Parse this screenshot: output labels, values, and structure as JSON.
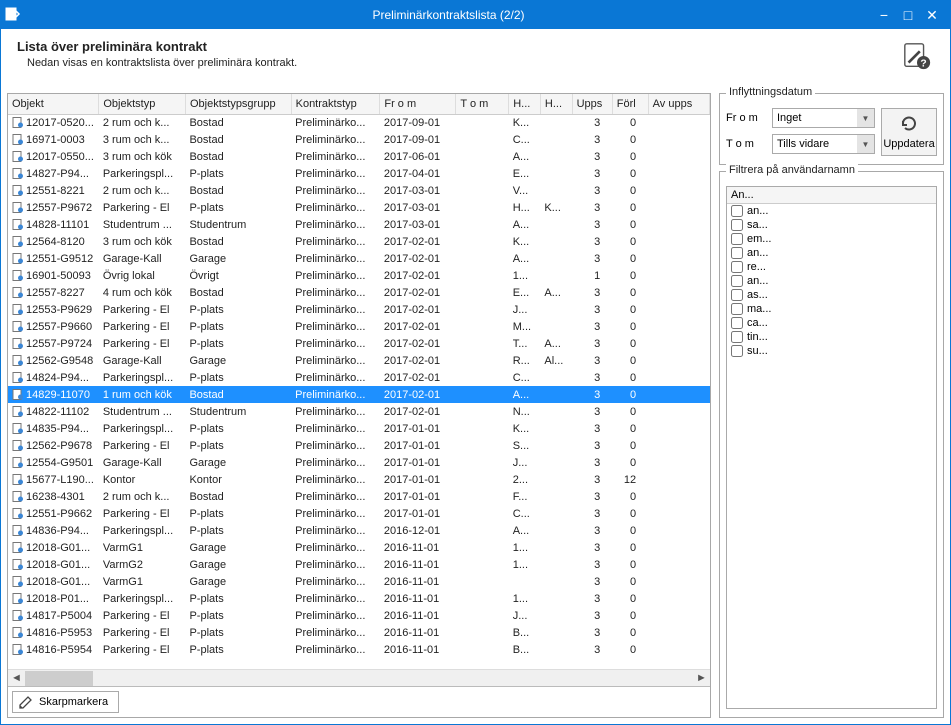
{
  "window": {
    "title": "Preliminärkontraktslista (2/2)"
  },
  "header": {
    "title": "Lista över preliminära kontrakt",
    "subtitle": "Nedan visas en kontraktslista över preliminära kontrakt."
  },
  "grid": {
    "columns": [
      "Objekt",
      "Objektstyp",
      "Objektstypsgrupp",
      "Kontraktstyp",
      "Fr o m",
      "T o m",
      "H...",
      "H...",
      "Upps",
      "Förl",
      "Av upps"
    ],
    "rows": [
      {
        "c": [
          "12017-0520...",
          "2 rum och k...",
          "Bostad",
          "Preliminärko...",
          "2017-09-01",
          "",
          "K...",
          "",
          "3",
          "0",
          ""
        ]
      },
      {
        "c": [
          "16971-0003",
          "3 rum och k...",
          "Bostad",
          "Preliminärko...",
          "2017-09-01",
          "",
          "C...",
          "",
          "3",
          "0",
          ""
        ]
      },
      {
        "c": [
          "12017-0550...",
          "3 rum och kök",
          "Bostad",
          "Preliminärko...",
          "2017-06-01",
          "",
          "A...",
          "",
          "3",
          "0",
          ""
        ]
      },
      {
        "c": [
          "14827-P94...",
          "Parkeringspl...",
          "P-plats",
          "Preliminärko...",
          "2017-04-01",
          "",
          "E...",
          "",
          "3",
          "0",
          ""
        ]
      },
      {
        "c": [
          "12551-8221",
          "2 rum och k...",
          "Bostad",
          "Preliminärko...",
          "2017-03-01",
          "",
          "V...",
          "",
          "3",
          "0",
          ""
        ]
      },
      {
        "c": [
          "12557-P9672",
          "Parkering - El",
          "P-plats",
          "Preliminärko...",
          "2017-03-01",
          "",
          "H...",
          "K...",
          "3",
          "0",
          ""
        ]
      },
      {
        "c": [
          "14828-11101",
          "Studentrum ...",
          "Studentrum",
          "Preliminärko...",
          "2017-03-01",
          "",
          "A...",
          "",
          "3",
          "0",
          ""
        ]
      },
      {
        "c": [
          "12564-8120",
          "3 rum och kök",
          "Bostad",
          "Preliminärko...",
          "2017-02-01",
          "",
          "K...",
          "",
          "3",
          "0",
          ""
        ]
      },
      {
        "c": [
          "12551-G9512",
          "Garage-Kall",
          "Garage",
          "Preliminärko...",
          "2017-02-01",
          "",
          "A...",
          "",
          "3",
          "0",
          ""
        ]
      },
      {
        "c": [
          "16901-50093",
          "Övrig lokal",
          "Övrigt",
          "Preliminärko...",
          "2017-02-01",
          "",
          "1...",
          "",
          "1",
          "0",
          ""
        ]
      },
      {
        "c": [
          "12557-8227",
          "4 rum och kök",
          "Bostad",
          "Preliminärko...",
          "2017-02-01",
          "",
          "E...",
          "A...",
          "3",
          "0",
          ""
        ]
      },
      {
        "c": [
          "12553-P9629",
          "Parkering - El",
          "P-plats",
          "Preliminärko...",
          "2017-02-01",
          "",
          "J...",
          "",
          "3",
          "0",
          ""
        ]
      },
      {
        "c": [
          "12557-P9660",
          "Parkering - El",
          "P-plats",
          "Preliminärko...",
          "2017-02-01",
          "",
          "M...",
          "",
          "3",
          "0",
          ""
        ]
      },
      {
        "c": [
          "12557-P9724",
          "Parkering - El",
          "P-plats",
          "Preliminärko...",
          "2017-02-01",
          "",
          "T...",
          "A...",
          "3",
          "0",
          ""
        ]
      },
      {
        "c": [
          "12562-G9548",
          "Garage-Kall",
          "Garage",
          "Preliminärko...",
          "2017-02-01",
          "",
          "R...",
          "Al...",
          "3",
          "0",
          ""
        ]
      },
      {
        "c": [
          "14824-P94...",
          "Parkeringspl...",
          "P-plats",
          "Preliminärko...",
          "2017-02-01",
          "",
          "C...",
          "",
          "3",
          "0",
          ""
        ]
      },
      {
        "c": [
          "14829-11070",
          "1 rum och kök",
          "Bostad",
          "Preliminärko...",
          "2017-02-01",
          "",
          "A...",
          "",
          "3",
          "0",
          ""
        ],
        "sel": true
      },
      {
        "c": [
          "14822-11102",
          "Studentrum ...",
          "Studentrum",
          "Preliminärko...",
          "2017-02-01",
          "",
          "N...",
          "",
          "3",
          "0",
          ""
        ]
      },
      {
        "c": [
          "14835-P94...",
          "Parkeringspl...",
          "P-plats",
          "Preliminärko...",
          "2017-01-01",
          "",
          "K...",
          "",
          "3",
          "0",
          ""
        ]
      },
      {
        "c": [
          "12562-P9678",
          "Parkering - El",
          "P-plats",
          "Preliminärko...",
          "2017-01-01",
          "",
          "S...",
          "",
          "3",
          "0",
          ""
        ]
      },
      {
        "c": [
          "12554-G9501",
          "Garage-Kall",
          "Garage",
          "Preliminärko...",
          "2017-01-01",
          "",
          "J...",
          "",
          "3",
          "0",
          ""
        ]
      },
      {
        "c": [
          "15677-L190...",
          "Kontor",
          "Kontor",
          "Preliminärko...",
          "2017-01-01",
          "",
          "2...",
          "",
          "3",
          "12",
          ""
        ]
      },
      {
        "c": [
          "16238-4301",
          "2 rum och k...",
          "Bostad",
          "Preliminärko...",
          "2017-01-01",
          "",
          "F...",
          "",
          "3",
          "0",
          ""
        ]
      },
      {
        "c": [
          "12551-P9662",
          "Parkering - El",
          "P-plats",
          "Preliminärko...",
          "2017-01-01",
          "",
          "C...",
          "",
          "3",
          "0",
          ""
        ]
      },
      {
        "c": [
          "14836-P94...",
          "Parkeringspl...",
          "P-plats",
          "Preliminärko...",
          "2016-12-01",
          "",
          "A...",
          "",
          "3",
          "0",
          ""
        ]
      },
      {
        "c": [
          "12018-G01...",
          "VarmG1",
          "Garage",
          "Preliminärko...",
          "2016-11-01",
          "",
          "1...",
          "",
          "3",
          "0",
          ""
        ]
      },
      {
        "c": [
          "12018-G01...",
          "VarmG2",
          "Garage",
          "Preliminärko...",
          "2016-11-01",
          "",
          "1...",
          "",
          "3",
          "0",
          ""
        ]
      },
      {
        "c": [
          "12018-G01...",
          "VarmG1",
          "Garage",
          "Preliminärko...",
          "2016-11-01",
          "",
          "",
          "",
          "3",
          "0",
          ""
        ]
      },
      {
        "c": [
          "12018-P01...",
          "Parkeringspl...",
          "P-plats",
          "Preliminärko...",
          "2016-11-01",
          "",
          "1...",
          "",
          "3",
          "0",
          ""
        ]
      },
      {
        "c": [
          "14817-P5004",
          "Parkering - El",
          "P-plats",
          "Preliminärko...",
          "2016-11-01",
          "",
          "J...",
          "",
          "3",
          "0",
          ""
        ]
      },
      {
        "c": [
          "14816-P5953",
          "Parkering - El",
          "P-plats",
          "Preliminärko...",
          "2016-11-01",
          "",
          "B...",
          "",
          "3",
          "0",
          ""
        ]
      },
      {
        "c": [
          "14816-P5954",
          "Parkering - El",
          "P-plats",
          "Preliminärko...",
          "2016-11-01",
          "",
          "B...",
          "",
          "3",
          "0",
          ""
        ]
      }
    ],
    "footer_button": "Skarpmarkera"
  },
  "side": {
    "date_title": "Inflyttningsdatum",
    "from_label": "Fr o m",
    "from_value": "Inget",
    "to_label": "T o m",
    "to_value": "Tills vidare",
    "update_button": "Uppdatera",
    "filter_title": "Filtrera på användarnamn",
    "filter_header": "An...",
    "users": [
      "an...",
      "sa...",
      "em...",
      "an...",
      "re...",
      "an...",
      "as...",
      "ma...",
      "ca...",
      "tin...",
      "su..."
    ]
  }
}
